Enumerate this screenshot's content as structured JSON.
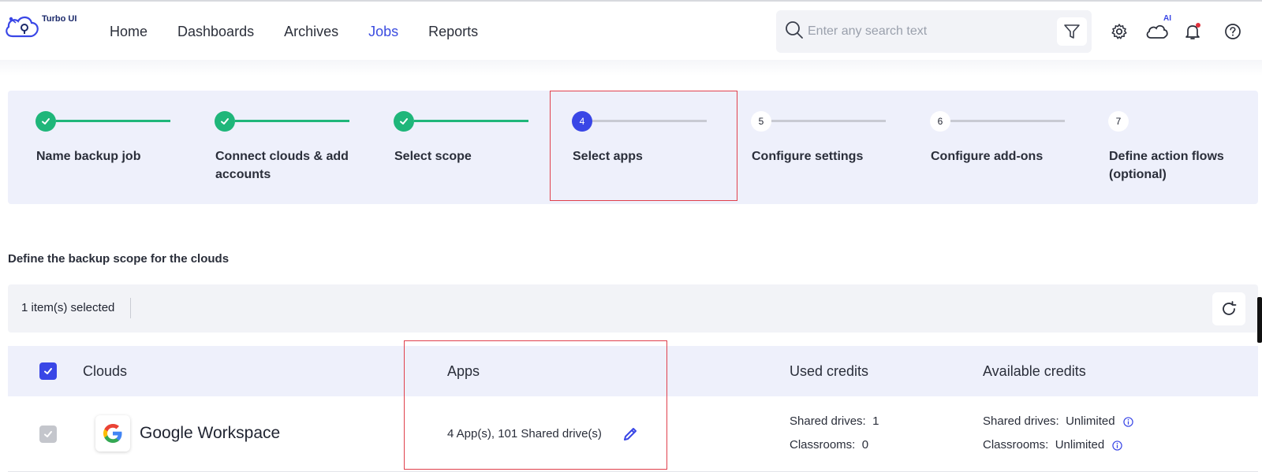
{
  "app": {
    "logo_text": "Turbo UI"
  },
  "nav": {
    "items": [
      {
        "label": "Home",
        "active": false
      },
      {
        "label": "Dashboards",
        "active": false
      },
      {
        "label": "Archives",
        "active": false
      },
      {
        "label": "Jobs",
        "active": true
      },
      {
        "label": "Reports",
        "active": false
      }
    ]
  },
  "search": {
    "placeholder": "Enter any search text",
    "value": ""
  },
  "header_icons": {
    "ai_badge": "AI"
  },
  "stepper": {
    "steps": [
      {
        "number": "1",
        "label": "Name backup job",
        "status": "done"
      },
      {
        "number": "2",
        "label": "Connect clouds & add accounts",
        "status": "done"
      },
      {
        "number": "3",
        "label": "Select scope",
        "status": "done"
      },
      {
        "number": "4",
        "label": "Select apps",
        "status": "current"
      },
      {
        "number": "5",
        "label": "Configure settings",
        "status": "future"
      },
      {
        "number": "6",
        "label": "Configure add-ons",
        "status": "future"
      },
      {
        "number": "7",
        "label": "Define action flows (optional)",
        "status": "future"
      }
    ]
  },
  "section": {
    "title": "Define the backup scope for the clouds"
  },
  "toolbar": {
    "selection_count": "1 item(s) selected"
  },
  "table": {
    "headers": {
      "clouds": "Clouds",
      "apps": "Apps",
      "used_credits": "Used credits",
      "available_credits": "Available credits"
    },
    "rows": [
      {
        "cloud": "Google Workspace",
        "apps": "4 App(s), 101 Shared drive(s)",
        "used": {
          "shared_drives_label": "Shared drives:",
          "shared_drives_value": "1",
          "classrooms_label": "Classrooms:",
          "classrooms_value": "0"
        },
        "available": {
          "shared_drives_label": "Shared drives:",
          "shared_drives_value": "Unlimited",
          "classrooms_label": "Classrooms:",
          "classrooms_value": "Unlimited"
        }
      }
    ]
  },
  "colors": {
    "accent": "#3946e6",
    "success": "#1fb67a",
    "highlight": "#e0404c"
  }
}
